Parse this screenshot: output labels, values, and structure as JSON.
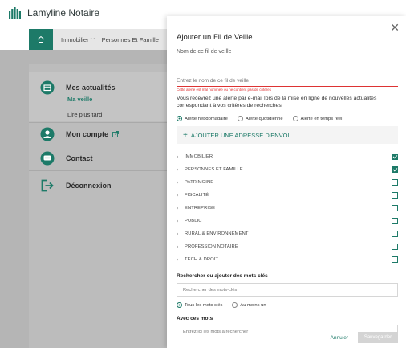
{
  "app": {
    "brand": "Lamyline Notaire"
  },
  "nav": {
    "items": [
      {
        "label": "Immobilier"
      },
      {
        "label": "Personnes Et Famille"
      }
    ]
  },
  "menu": {
    "actualites": "Mes actualités",
    "veille": "Ma veille",
    "lire": "Lire plus tard",
    "compte": "Mon compte",
    "contact": "Contact",
    "deconnexion": "Déconnexion"
  },
  "modal": {
    "title": "Ajouter un Fil de Veille",
    "name_label": "Nom de ce fil de veille",
    "name_placeholder": "Entrez le nom de ce fil de veille",
    "error": "Cette alerte est mal nommée ou ne contient pas de critères",
    "info": "Vous recevrez une alerte par e-mail lors de la mise en ligne de nouvelles actualités correspondant à vos critères de recherches",
    "frequency": [
      {
        "label": "Alerte hebdomadaire",
        "checked": true
      },
      {
        "label": "Alerte quotidienne",
        "checked": false
      },
      {
        "label": "Alerte en temps réel",
        "checked": false
      }
    ],
    "add_address": "AJOUTER UNE ADRESSE D'ENVOI",
    "categories": [
      {
        "label": "IMMOBILIER",
        "checked": true
      },
      {
        "label": "PERSONNES ET FAMILLE",
        "checked": true
      },
      {
        "label": "PATRIMOINE",
        "checked": false
      },
      {
        "label": "FISCALITÉ",
        "checked": false
      },
      {
        "label": "ENTREPRISE",
        "checked": false
      },
      {
        "label": "PUBLIC",
        "checked": false
      },
      {
        "label": "RURAL & ENVIRONNEMENT",
        "checked": false
      },
      {
        "label": "PROFESSION NOTAIRE",
        "checked": false
      },
      {
        "label": "TECH & DROIT",
        "checked": false
      }
    ],
    "keywords_label": "Rechercher ou ajouter des mots clés",
    "keywords_placeholder": "Rechercher des mots-clés",
    "match": [
      {
        "label": "Tous les mots clés",
        "checked": true
      },
      {
        "label": "Au moins un",
        "checked": false
      }
    ],
    "with_words_label": "Avec ces mots",
    "with_words_placeholder": "Entrez ici les mots à rechercher",
    "cancel": "Annuler",
    "save": "Sauvegarder"
  },
  "colors": {
    "accent": "#1d7a68",
    "error": "#dd3333"
  }
}
